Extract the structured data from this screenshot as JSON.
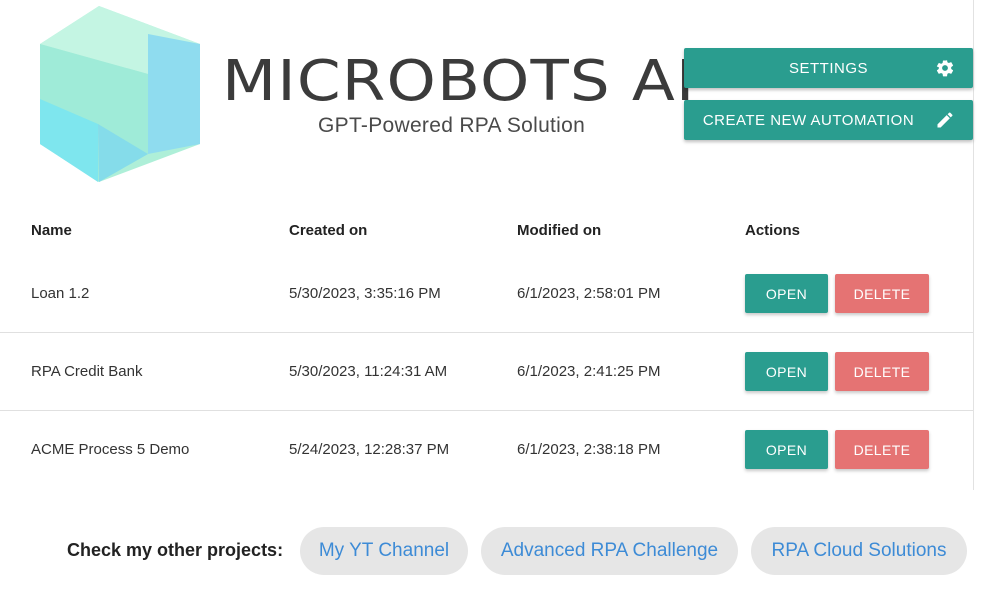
{
  "brand": {
    "title": "MICROBOTS AI",
    "subtitle": "GPT-Powered RPA Solution",
    "logo_icon": "hexagon-logo-icon",
    "colors": {
      "accent": "#2a9d8f",
      "danger": "#e57373",
      "link": "#3d8bd6"
    }
  },
  "toolbar": {
    "settings_label": "SETTINGS",
    "settings_icon": "gear-icon",
    "create_label": "CREATE NEW AUTOMATION",
    "create_icon": "pencil-icon"
  },
  "table": {
    "headers": [
      "Name",
      "Created on",
      "Modified on",
      "Actions"
    ],
    "rows": [
      {
        "name": "Loan 1.2",
        "created": "5/30/2023, 3:35:16 PM",
        "modified": "6/1/2023, 2:58:01 PM",
        "open": "OPEN",
        "delete": "DELETE"
      },
      {
        "name": "RPA Credit Bank",
        "created": "5/30/2023, 11:24:31 AM",
        "modified": "6/1/2023, 2:41:25 PM",
        "open": "OPEN",
        "delete": "DELETE"
      },
      {
        "name": "ACME Process 5 Demo",
        "created": "5/24/2023, 12:28:37 PM",
        "modified": "6/1/2023, 2:38:18 PM",
        "open": "OPEN",
        "delete": "DELETE"
      }
    ]
  },
  "footer": {
    "label": "Check my other projects:",
    "links": [
      "My YT Channel",
      "Advanced RPA Challenge",
      "RPA Cloud Solutions"
    ]
  }
}
